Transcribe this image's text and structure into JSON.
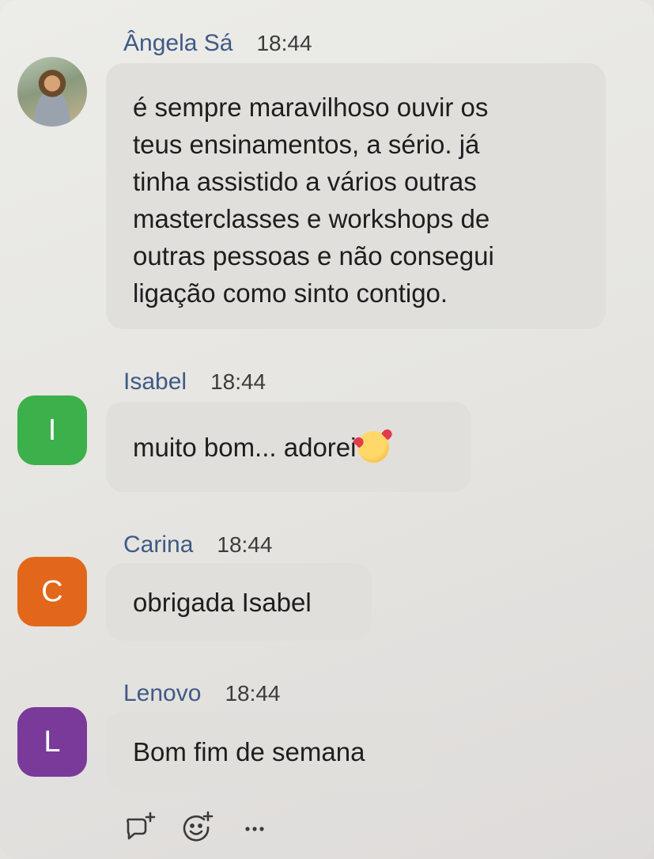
{
  "messages": [
    {
      "sender": "Ângela Sá",
      "time": "18:44",
      "avatar": {
        "type": "photo",
        "letter": "",
        "color": ""
      },
      "text": "é sempre maravilhoso ouvir os\nteus ensinamentos, a sério. já\ntinha assistido a vários outras\nmasterclasses e workshops de\noutras pessoas e não consegui\nligação como sinto contigo."
    },
    {
      "sender": "Isabel",
      "time": "18:44",
      "avatar": {
        "type": "letter",
        "letter": "I",
        "color": "#3cb04a"
      },
      "text": "muito bom... adorei",
      "emoji": "smiling-face-with-hearts"
    },
    {
      "sender": "Carina",
      "time": "18:44",
      "avatar": {
        "type": "letter",
        "letter": "C",
        "color": "#e2671a"
      },
      "text": "obrigada Isabel"
    },
    {
      "sender": "Lenovo",
      "time": "18:44",
      "avatar": {
        "type": "letter",
        "letter": "L",
        "color": "#7a3a9a"
      },
      "text": "Bom fim de semana"
    }
  ],
  "actions": [
    {
      "icon": "reply-in-thread-icon"
    },
    {
      "icon": "add-reaction-icon"
    },
    {
      "icon": "more-options-icon"
    }
  ],
  "colors": {
    "sender": "#3f5a86",
    "bubble": "#e0dfdc",
    "text": "#1e1e1e"
  }
}
